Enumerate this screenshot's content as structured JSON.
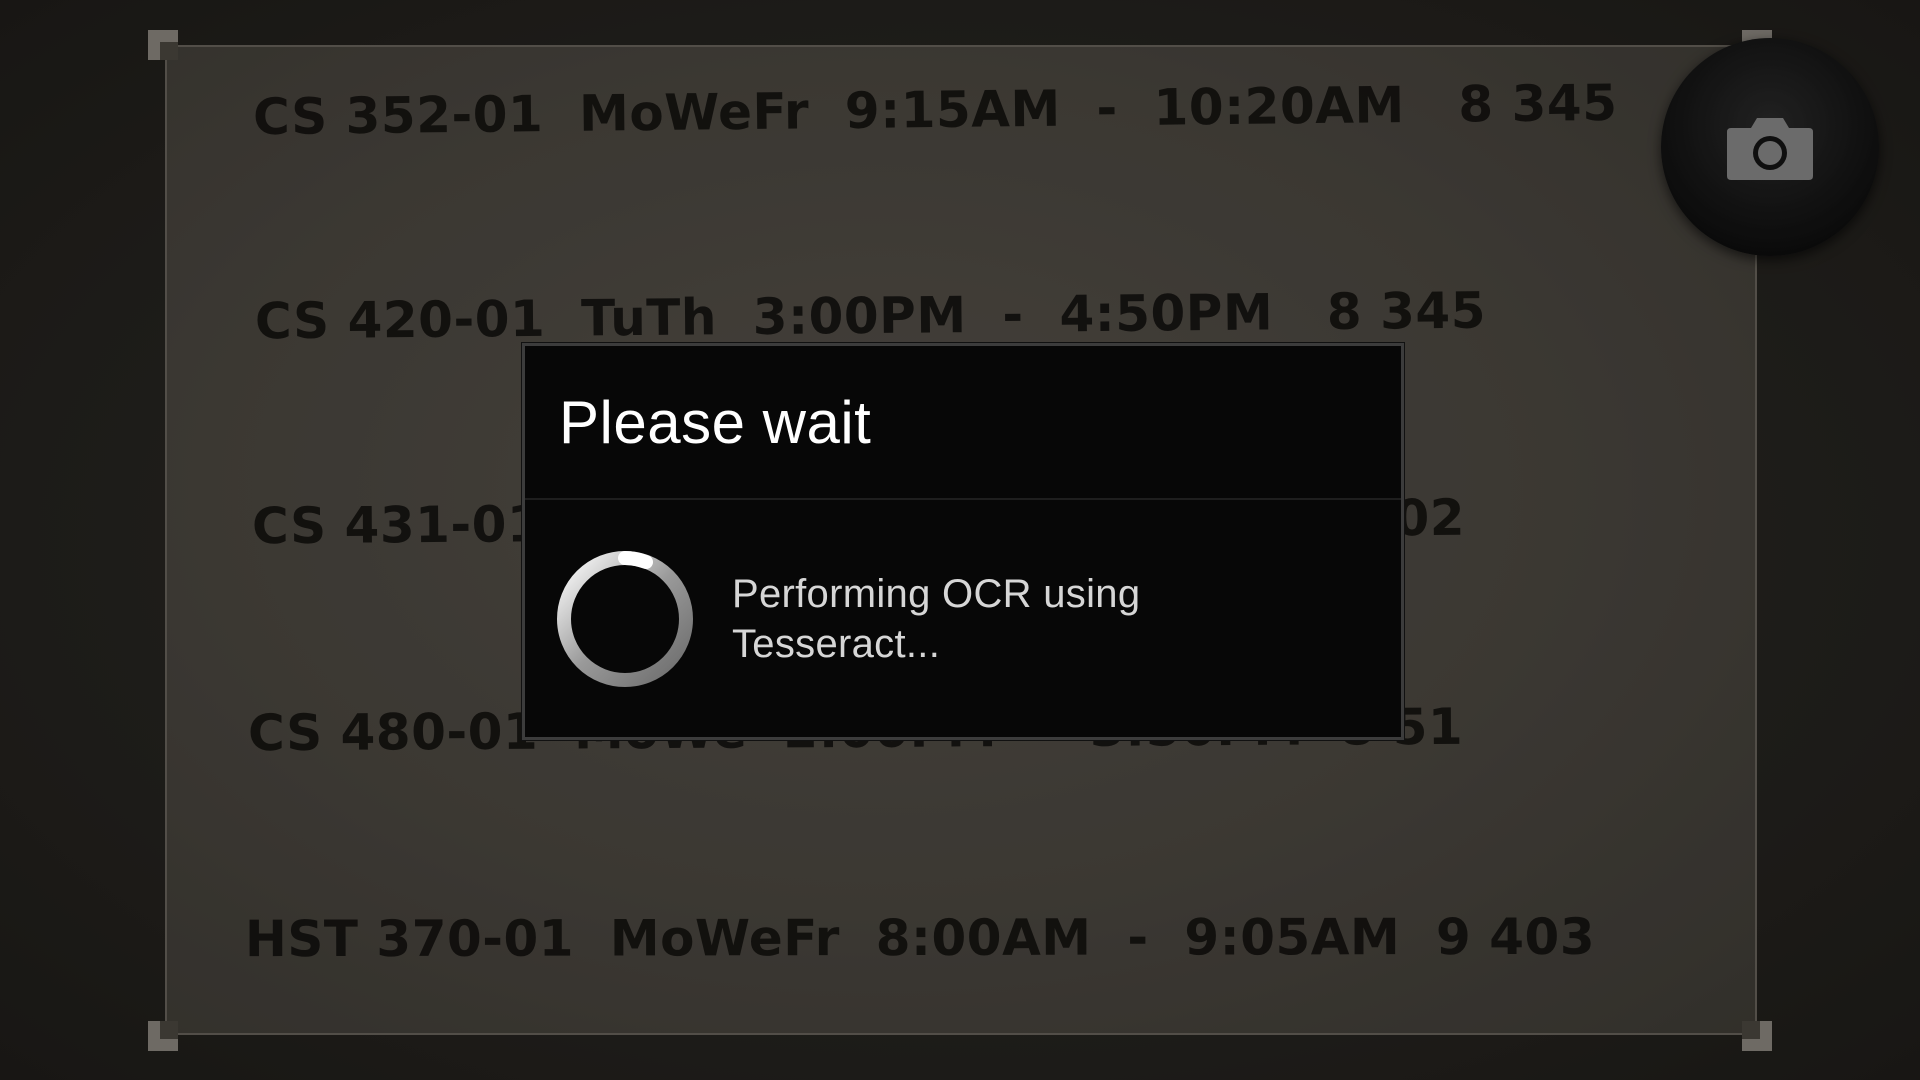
{
  "document": {
    "lines": [
      "CS 352-01  MoWeFr  9:15AM  -  10:20AM   8 345",
      "CS 420-01  TuTh  3:00PM  -  4:50PM   8 345",
      "CS 431-01  TuTh  1:00PM  -  2:50PM  8 302",
      "CS 480-01  MoWe  2:00PM  -  3:50PM  8 51",
      "HST 370-01  MoWeFr  8:00AM  -  9:05AM  9 403"
    ]
  },
  "shutter": {
    "icon": "camera-icon"
  },
  "dialog": {
    "title": "Please wait",
    "message": "Performing OCR using Tesseract...",
    "spinner_icon": "progress-spinner-icon"
  }
}
